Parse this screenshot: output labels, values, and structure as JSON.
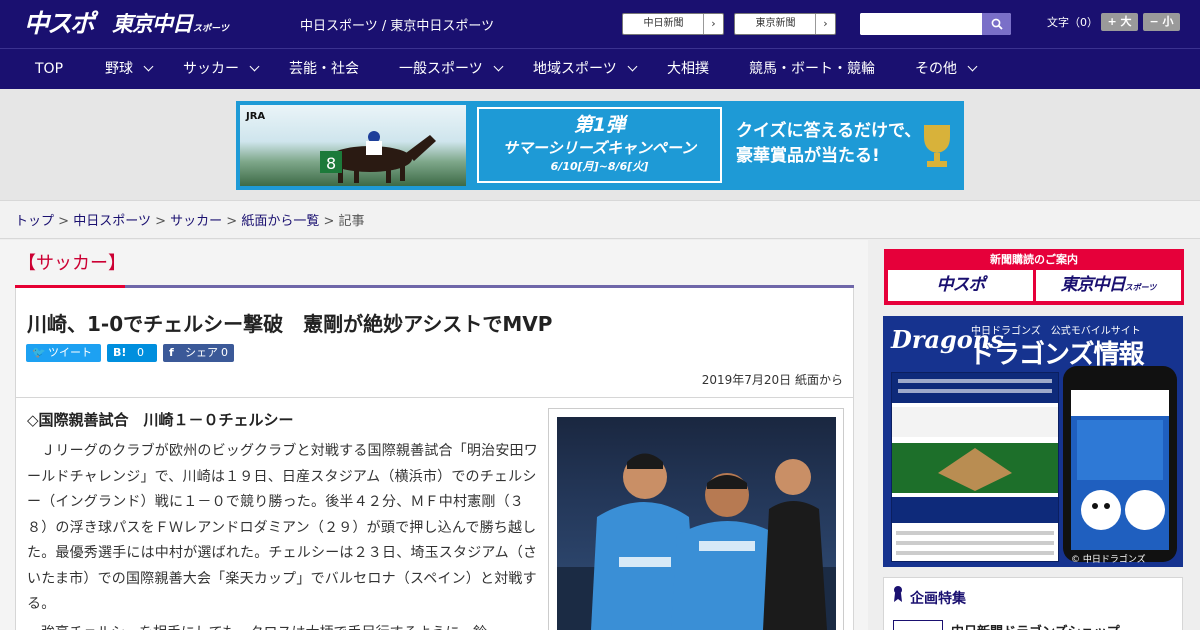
{
  "header": {
    "logo_chuspo": "中スポ",
    "logo_tokyo": "東京中日",
    "logo_tokyo_small": "スポーツ",
    "site_name": "中日スポーツ / 東京中日スポーツ",
    "link_chunichi": "中日新聞",
    "link_tokyo": "東京新聞",
    "search_placeholder": "",
    "font_size_label": "文字（0）",
    "font_larger": "+ 大",
    "font_smaller": "− 小",
    "colors": {
      "brand": "#1a1070",
      "accent": "#e60033"
    }
  },
  "nav": {
    "items": [
      {
        "label": "TOP",
        "dropdown": false
      },
      {
        "label": "野球",
        "dropdown": true
      },
      {
        "label": "サッカー",
        "dropdown": true
      },
      {
        "label": "芸能・社会",
        "dropdown": false
      },
      {
        "label": "一般スポーツ",
        "dropdown": true
      },
      {
        "label": "地域スポーツ",
        "dropdown": true
      },
      {
        "label": "大相撲",
        "dropdown": false
      },
      {
        "label": "競馬・ボート・競輪",
        "dropdown": false
      },
      {
        "label": "その他",
        "dropdown": true
      }
    ]
  },
  "banner": {
    "jra": "JRA",
    "campaign_line1": "第1弾",
    "campaign_line2": "サマーシリーズキャンペーン",
    "campaign_dates": "6/10[月]~8/6[火]",
    "copy_line1": "クイズに答えるだけで、",
    "copy_line2": "豪華賞品が当たる!"
  },
  "breadcrumb": {
    "items": [
      "トップ",
      "中日スポーツ",
      "サッカー",
      "紙面から一覧"
    ],
    "current": "記事",
    "separator": ">"
  },
  "article": {
    "section": "【サッカー】",
    "headline": "川崎、1-0でチェルシー撃破　憲剛が絶妙アシストでMVP",
    "share_tweet": "ツイート",
    "share_hatena_icon": "B!",
    "share_hatena_count": "0",
    "share_fb": "シェア",
    "share_fb_count": "0",
    "date": "2019年7月20日 紙面から",
    "subhead": "◇国際親善試合　川崎１－０チェルシー",
    "body": "　Ｊリーグのクラブが欧州のビッグクラブと対戦する国際親善試合「明治安田ワールドチャレンジ」で、川崎は１９日、日産スタジアム（横浜市）でのチェルシー（イングランド）戦に１－０で競り勝った。後半４２分、ＭＦ中村憲剛（３８）の浮き球パスをＦＷレアンドロダミアン（２９）が頭で押し込んで勝ち越した。最優秀選手には中村が選ばれた。チェルシーは２３日、埼玉スタジアム（さいたま市）での国際親善大会「楽天カップ」でバルセロナ（スペイン）と対戦する。",
    "body_next": "　強豪チェルシーを相手にしても、クロスは大柄で手足行するように、鈴"
  },
  "sidebar": {
    "subscribe_title": "新聞購読のご案内",
    "subscribe_chuspo": "中スポ",
    "subscribe_tokyo": "東京中日",
    "subscribe_tokyo_small": "スポーツ",
    "dragons_logo": "Dragons",
    "dragons_sub": "中日ドラゴンズ　公式モバイルサイト",
    "dragons_big": "ドラゴンズ情報",
    "dragons_copy": "© 中日ドラゴンズ",
    "feature_title": "企画特集",
    "feature_item": "中日新聞ドラゴンズショップ"
  }
}
